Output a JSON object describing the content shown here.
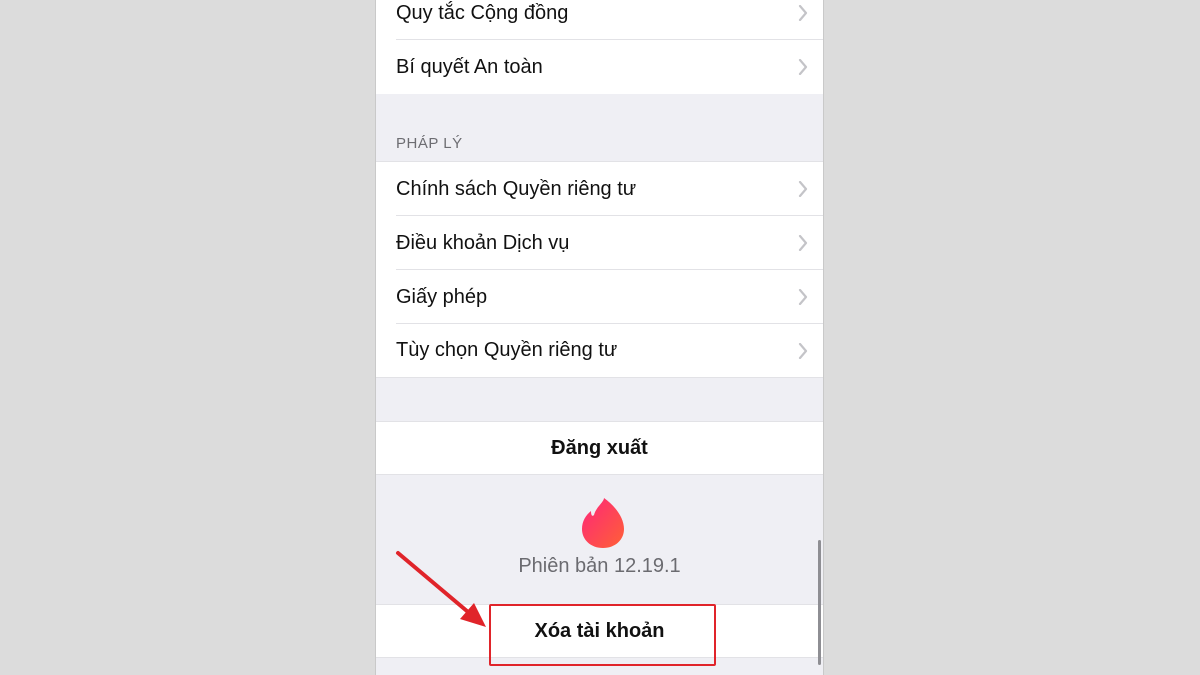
{
  "group_top": {
    "items": [
      {
        "label": "Quy tắc Cộng đồng",
        "icon": "chevron-right-icon"
      },
      {
        "label": "Bí quyết An toàn",
        "icon": "chevron-right-icon"
      }
    ]
  },
  "legal": {
    "header": "PHÁP LÝ",
    "items": [
      {
        "label": "Chính sách Quyền riêng tư",
        "icon": "chevron-right-icon"
      },
      {
        "label": "Điều khoản Dịch vụ",
        "icon": "chevron-right-icon"
      },
      {
        "label": "Giấy phép",
        "icon": "chevron-right-icon"
      },
      {
        "label": "Tùy chọn Quyền riêng tư",
        "icon": "chevron-right-icon"
      }
    ]
  },
  "logout": {
    "label": "Đăng xuất"
  },
  "app": {
    "logo_icon": "flame-icon",
    "version": "Phiên bản 12.19.1"
  },
  "delete_account": {
    "label": "Xóa tài khoản"
  },
  "colors": {
    "background": "#efeff4",
    "annotation_red": "#e0242a",
    "logo_gradient_start": "#fd267a",
    "logo_gradient_end": "#ff6036"
  }
}
